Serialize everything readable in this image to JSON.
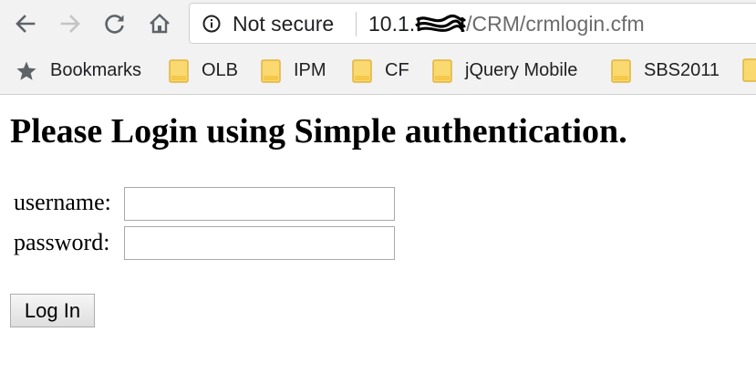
{
  "browser": {
    "security_label": "Not secure",
    "url": {
      "host_prefix": "10.1.",
      "path": "/CRM/crmlogin.cfm"
    },
    "bookmarks": [
      {
        "label": "Bookmarks",
        "icon": "star-icon"
      },
      {
        "label": "OLB",
        "icon": "folder-icon"
      },
      {
        "label": "IPM",
        "icon": "folder-icon"
      },
      {
        "label": "CF",
        "icon": "folder-icon"
      },
      {
        "label": "jQuery Mobile",
        "icon": "folder-icon"
      },
      {
        "label": "SBS2011",
        "icon": "folder-icon"
      }
    ],
    "colors": {
      "chrome_background": "#f2f2f2",
      "folder_fill": "#f9d970",
      "folder_outline": "#e0b43c",
      "icon_gray": "#5f6368"
    }
  },
  "page": {
    "title": "Please Login using Simple authentication.",
    "form": {
      "username_label": "username:",
      "username_value": "",
      "password_label": "password:",
      "password_value": "",
      "submit_label": "Log In"
    }
  }
}
